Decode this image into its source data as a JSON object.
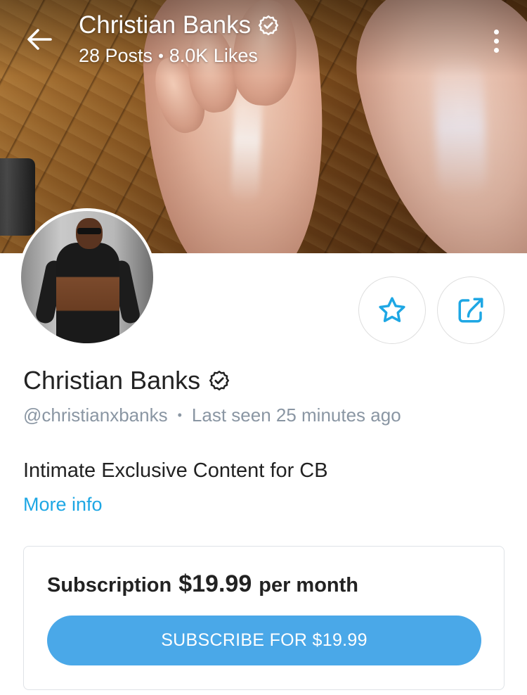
{
  "header": {
    "title": "Christian Banks",
    "posts": "28 Posts",
    "separator": "•",
    "likes": "8.0K Likes",
    "back_icon": "arrow-left-icon",
    "more_icon": "more-vertical-icon",
    "verified_icon": "verified-badge-icon"
  },
  "profile": {
    "name": "Christian Banks",
    "handle": "@christianxbanks",
    "meta_separator": "•",
    "last_seen": "Last seen 25 minutes ago",
    "bio": "Intimate Exclusive Content for CB",
    "more_info_label": "More info",
    "star_icon": "star-icon",
    "share_icon": "share-icon"
  },
  "subscription": {
    "label": "Subscription",
    "price": "$19.99",
    "period": "per month",
    "button_label": "SUBSCRIBE FOR $19.99"
  },
  "colors": {
    "accent": "#1ea7e4",
    "button": "#4aa8e8",
    "muted_text": "#8a96a3"
  }
}
